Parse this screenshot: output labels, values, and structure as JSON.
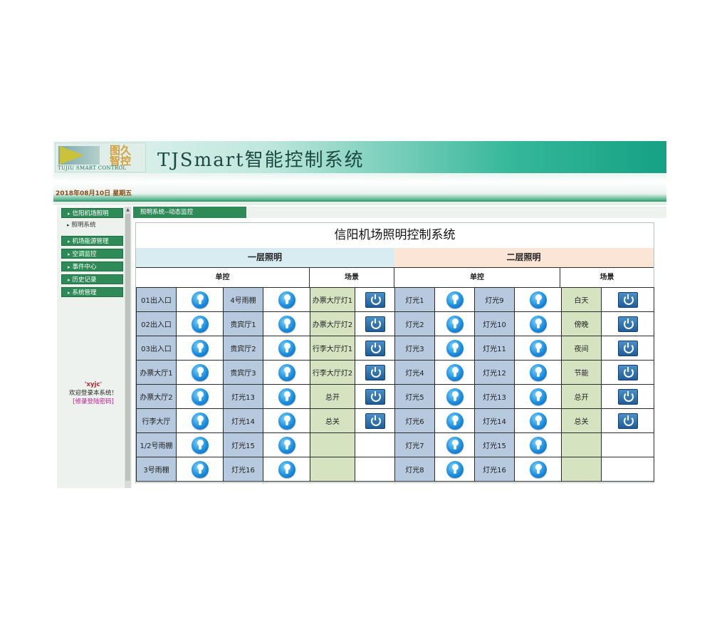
{
  "header": {
    "logo_cn_line1": "图久",
    "logo_cn_line2": "智控",
    "logo_en": "TUJIU SMART CONTROL",
    "title": "TJSmart智能控制系统"
  },
  "date": "2018年08月10日 星期五",
  "sidebar": {
    "items": [
      {
        "label": "信阳机场照明"
      },
      {
        "label": "照明系统"
      },
      {
        "label": "机场能源管理"
      },
      {
        "label": "空调监控"
      },
      {
        "label": "事件中心"
      },
      {
        "label": "历史记录"
      },
      {
        "label": "系统管理"
      }
    ],
    "user": {
      "name": "'xyjc'",
      "welcome": "欢迎登录本系统！",
      "change_password": "[修录登陆密码]"
    }
  },
  "tab": {
    "label": "照明系统--动态监控"
  },
  "panel": {
    "title": "信阳机场照明控制系统",
    "floor1": {
      "label": "一层照明",
      "color": "#d9ecf2",
      "single_label": "单控",
      "scene_label": "场景"
    },
    "floor2": {
      "label": "二层照明",
      "color": "#fbe5d6",
      "single_label": "单控",
      "scene_label": "场景"
    },
    "rows": [
      {
        "f1a": "01出入口",
        "f1b": "4号雨棚",
        "f1s": "办票大厅灯1",
        "f2a": "灯光1",
        "f2b": "灯光9",
        "f2s": "白天"
      },
      {
        "f1a": "02出入口",
        "f1b": "贵宾厅1",
        "f1s": "办票大厅灯2",
        "f2a": "灯光2",
        "f2b": "灯光10",
        "f2s": "傍晚"
      },
      {
        "f1a": "03出入口",
        "f1b": "贵宾厅2",
        "f1s": "行李大厅灯1",
        "f2a": "灯光3",
        "f2b": "灯光11",
        "f2s": "夜间"
      },
      {
        "f1a": "办票大厅1",
        "f1b": "贵宾厅3",
        "f1s": "行李大厅灯2",
        "f2a": "灯光4",
        "f2b": "灯光12",
        "f2s": "节能"
      },
      {
        "f1a": "办票大厅2",
        "f1b": "灯光13",
        "f1s": "总开",
        "f2a": "灯光5",
        "f2b": "灯光13",
        "f2s": "总开"
      },
      {
        "f1a": "行李大厅",
        "f1b": "灯光14",
        "f1s": "总关",
        "f2a": "灯光6",
        "f2b": "灯光14",
        "f2s": "总关"
      },
      {
        "f1a": "1/2号雨棚",
        "f1b": "灯光15",
        "f1s": "",
        "f2a": "灯光7",
        "f2b": "灯光15",
        "f2s": ""
      },
      {
        "f1a": "3号雨棚",
        "f1b": "灯光16",
        "f1s": "",
        "f2a": "灯光8",
        "f2b": "灯光16",
        "f2s": ""
      }
    ]
  },
  "colors": {
    "nav_green": "#2e8b57",
    "label_blue": "#b6c9de",
    "scene_green": "#d5e3c0",
    "date_brown": "#8a4a12"
  },
  "icons": {
    "light": "bulb-icon",
    "scene": "power-icon"
  }
}
